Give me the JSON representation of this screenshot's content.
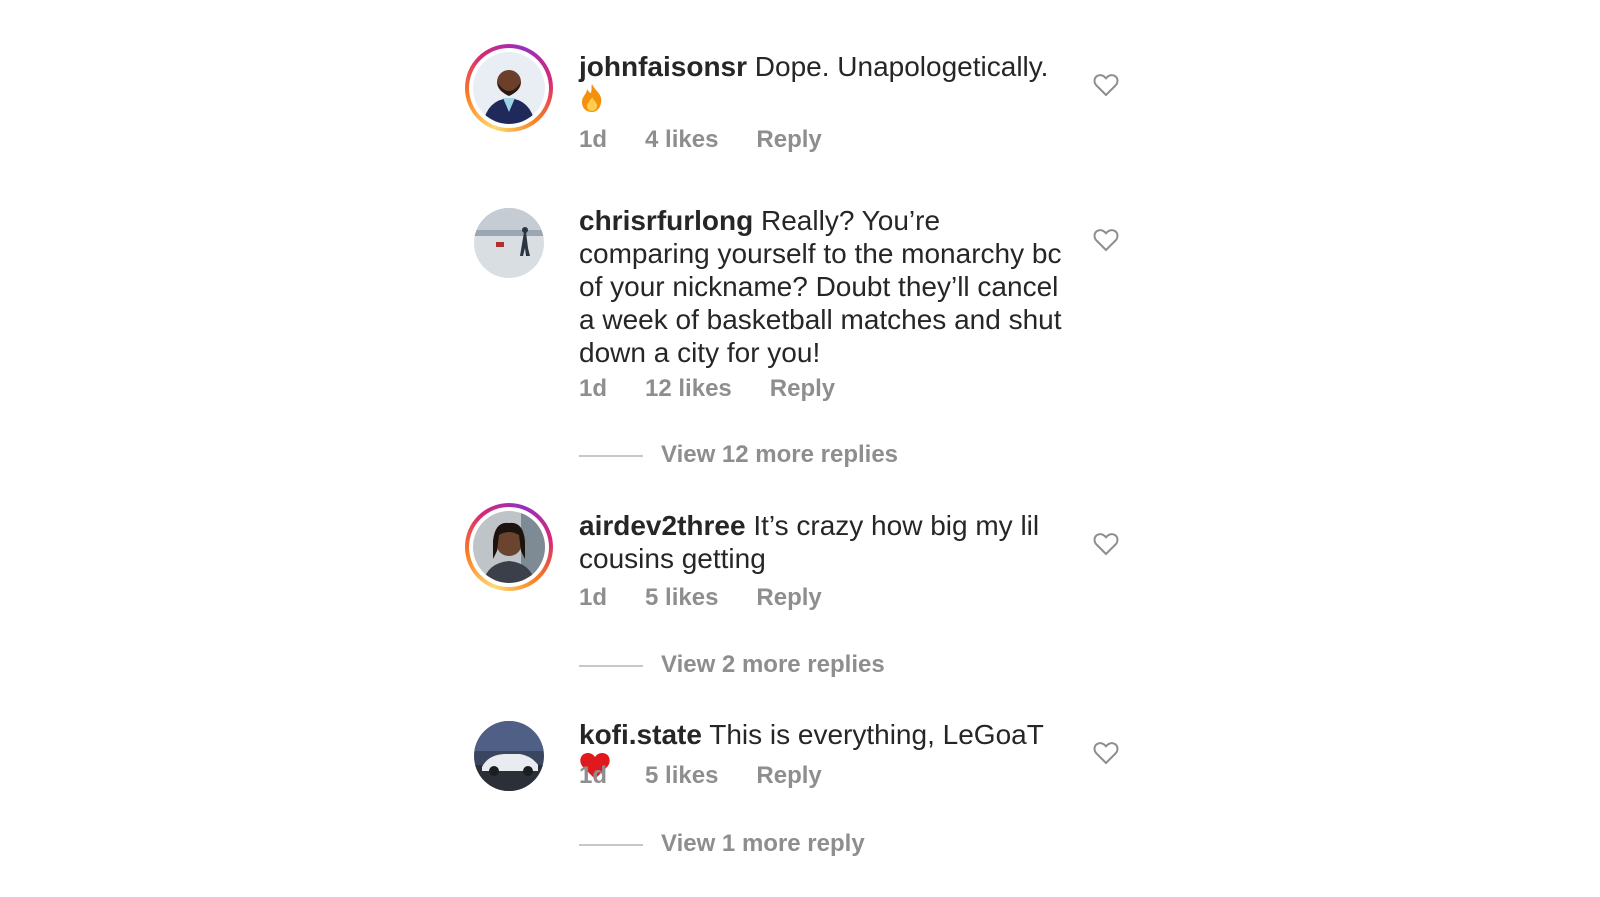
{
  "comments": [
    {
      "username": "johnfaisonsr",
      "text": "Dope. Unapologetically.",
      "emoji": "🔥",
      "time": "1d",
      "likes": "4 likes",
      "reply": "Reply",
      "has_story": true
    },
    {
      "username": "chrisrfurlong",
      "text": "Really? You’re comparing yourself to the monarchy bc of your nickname? Doubt they’ll cancel a week of basketball matches and shut down a city for you!",
      "time": "1d",
      "likes": "12 likes",
      "reply": "Reply",
      "view_replies": "View 12 more replies",
      "has_story": false
    },
    {
      "username": "airdev2three",
      "text": "It’s crazy how big my lil cousins getting",
      "time": "1d",
      "likes": "5 likes",
      "reply": "Reply",
      "view_replies": "View 2 more replies",
      "has_story": true
    },
    {
      "username": "kofi.state",
      "text": "This is everything, LeGoaT",
      "emoji": "❤️",
      "time": "1d",
      "likes": "5 likes",
      "reply": "Reply",
      "view_replies": "View 1 more reply",
      "has_story": false
    }
  ],
  "colors": {
    "text": "#262626",
    "meta": "#8e8e8e",
    "heart_outline": "#8e8e8e",
    "red_heart": "#e0191f"
  },
  "icons": {
    "like": "heart-outline-icon",
    "fire": "fire-emoji-icon",
    "red_heart": "red-heart-emoji-icon"
  }
}
